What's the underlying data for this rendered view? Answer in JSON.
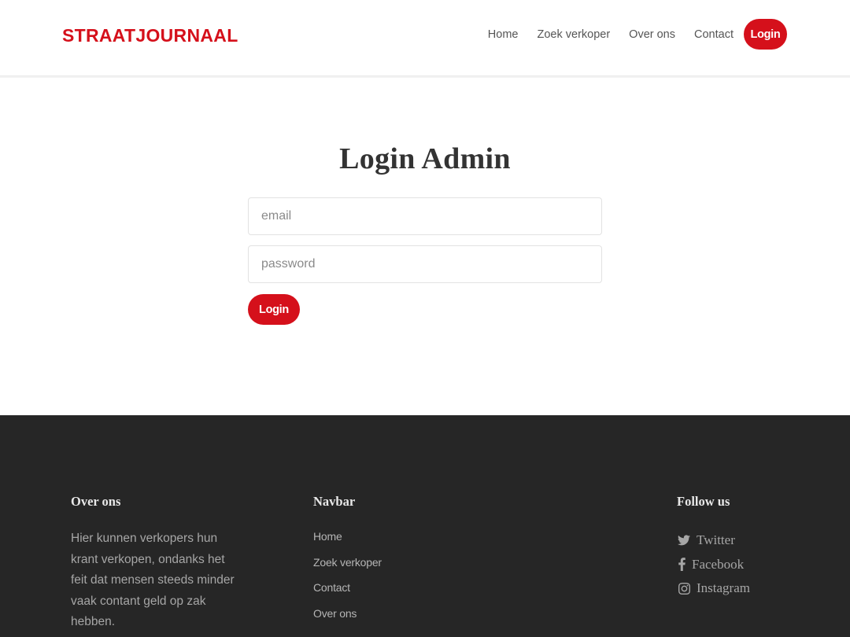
{
  "header": {
    "brand": "STRAATJOURNAAL",
    "nav": [
      "Home",
      "Zoek verkoper",
      "Over ons",
      "Contact"
    ],
    "login_label": "Login"
  },
  "main": {
    "title": "Login Admin",
    "email_placeholder": "email",
    "password_placeholder": "password",
    "submit_label": "Login"
  },
  "footer": {
    "about": {
      "heading": "Over ons",
      "text": "Hier kunnen verkopers hun krant verkopen, ondanks het feit dat mensen steeds minder vaak contant geld op zak hebben."
    },
    "navbar": {
      "heading": "Navbar",
      "links": [
        "Home",
        "Zoek verkoper",
        "Contact",
        "Over ons"
      ]
    },
    "follow": {
      "heading": "Follow us",
      "items": [
        {
          "label": "Twitter",
          "icon": "twitter-icon"
        },
        {
          "label": "Facebook",
          "icon": "facebook-icon"
        },
        {
          "label": "Instagram",
          "icon": "instagram-icon"
        }
      ]
    }
  },
  "colors": {
    "accent": "#d5101b",
    "footer_bg": "#262626"
  }
}
